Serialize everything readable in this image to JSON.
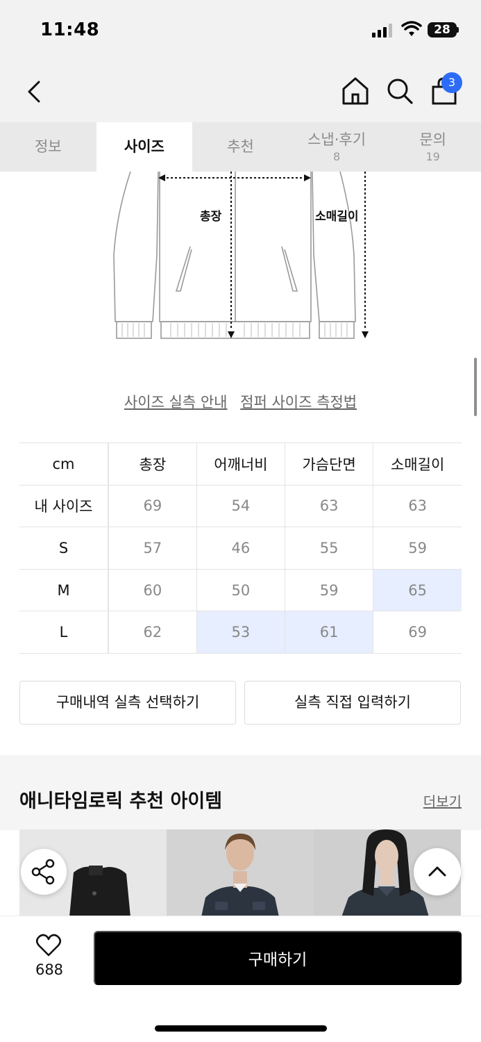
{
  "status_bar": {
    "time": "11:48",
    "battery": "28"
  },
  "header": {
    "cart_count": "3"
  },
  "tabs": [
    {
      "label": "정보",
      "count": ""
    },
    {
      "label": "사이즈",
      "count": ""
    },
    {
      "label": "추천",
      "count": ""
    },
    {
      "label": "스냅·후기",
      "count": "8"
    },
    {
      "label": "문의",
      "count": "19"
    }
  ],
  "diagram": {
    "length_label": "총장",
    "sleeve_label": "소매길이"
  },
  "guide_links": {
    "size_guide": "사이즈 실측 안내",
    "measure_method": "점퍼 사이즈 측정법"
  },
  "size_table": {
    "headers": [
      "cm",
      "총장",
      "어깨너비",
      "가슴단면",
      "소매길이"
    ],
    "rows": [
      {
        "label": "내 사이즈",
        "values": [
          "69",
          "54",
          "63",
          "63"
        ]
      },
      {
        "label": "S",
        "values": [
          "57",
          "46",
          "55",
          "59"
        ]
      },
      {
        "label": "M",
        "values": [
          "60",
          "50",
          "59",
          "65"
        ]
      },
      {
        "label": "L",
        "values": [
          "62",
          "53",
          "61",
          "69"
        ]
      }
    ],
    "highlight_color": "#e6eeff"
  },
  "actions": {
    "history": "구매내역 실측 선택하기",
    "direct": "실측 직접 입력하기"
  },
  "recommend": {
    "title": "애니타임로릭 추천 아이템",
    "more": "더보기"
  },
  "bottom_bar": {
    "like_count": "688",
    "buy": "구매하기"
  },
  "colors": {
    "accent": "#2d6cf6",
    "buy_button": "#000000"
  }
}
